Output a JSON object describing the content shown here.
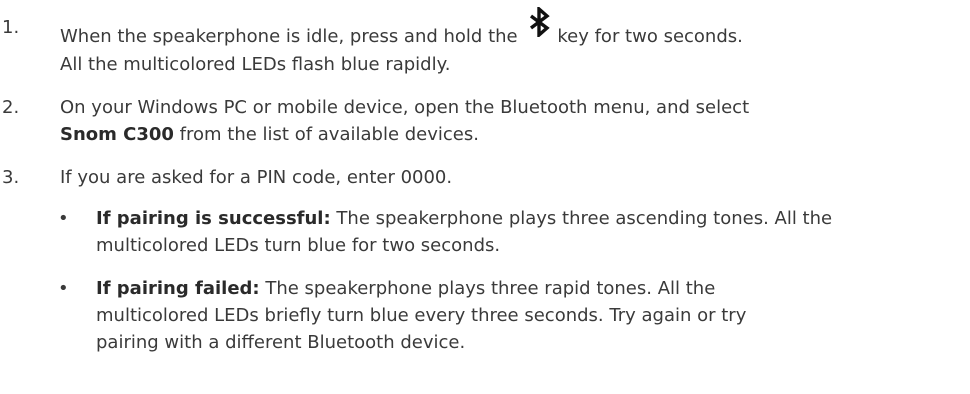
{
  "steps": [
    {
      "number": "1.",
      "text_before_icon": "When the speakerphone is idle, press and hold the",
      "icon": "bluetooth-icon",
      "text_after_icon": "key for two seconds.",
      "note": "All the multicolored LEDs flash blue rapidly."
    },
    {
      "number": "2.",
      "line1": "On your Windows PC or mobile device, open the Bluetooth menu, and select",
      "bold": "Snom C300",
      "line2_rest": " from the list of available devices."
    },
    {
      "number": "3.",
      "text": "If you are asked for a PIN code, enter 0000."
    }
  ],
  "bullets": [
    {
      "label": "If pairing is successful:",
      "line1_rest": " The speakerphone plays three ascending tones. All the",
      "line2": "multicolored LEDs turn blue for two seconds."
    },
    {
      "label": "If pairing failed:",
      "line1_rest": " The speakerphone plays three rapid tones. All the",
      "line2": "multicolored LEDs briefly turn blue every three seconds. Try again or try",
      "line3": "pairing with a different Bluetooth device."
    }
  ],
  "bullet_char": "•",
  "colors": {
    "text": "#3a3a3a",
    "icon": "#111111"
  }
}
